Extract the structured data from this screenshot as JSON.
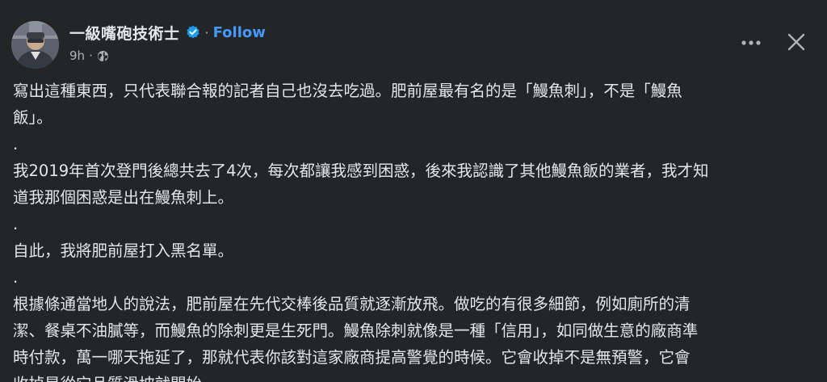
{
  "post": {
    "author": "一級嘴砲技術士",
    "separator": "·",
    "follow_label": "Follow",
    "timestamp": "9h",
    "meta_separator": "·",
    "paragraphs": [
      "寫出這種東西，只代表聯合報的記者自己也沒去吃過。肥前屋最有名的是「鰻魚刺」，不是「鰻魚",
      "飯」。",
      ".",
      "我2019年首次登門後總共去了4次，每次都讓我感到困惑，後來我認識了其他鰻魚飯的業者，我才知",
      "道我那個困惑是出在鰻魚刺上。",
      ".",
      "自此，我將肥前屋打入黑名單。",
      ".",
      "根據條通當地人的說法，肥前屋在先代交棒後品質就逐漸放飛。做吃的有很多細節，例如廁所的清",
      "潔、餐桌不油膩等，而鰻魚的除刺更是生死門。鰻魚除刺就像是一種「信用」，如同做生意的廠商準",
      "時付款，萬一哪天拖延了，那就代表你該對這家廠商提高警覺的時候。它會收掉不是無預警，它會",
      "收掉是從它品質滑坡就開始。"
    ]
  },
  "icons": {
    "verified": "verified-badge-icon",
    "audience": "globe-icon",
    "more": "more-options-icon",
    "close": "close-icon"
  },
  "colors": {
    "background": "#242526",
    "text": "#e4e6eb",
    "secondary_text": "#b0b3b8",
    "link": "#4599ff",
    "verified": "#1d9bf0"
  }
}
